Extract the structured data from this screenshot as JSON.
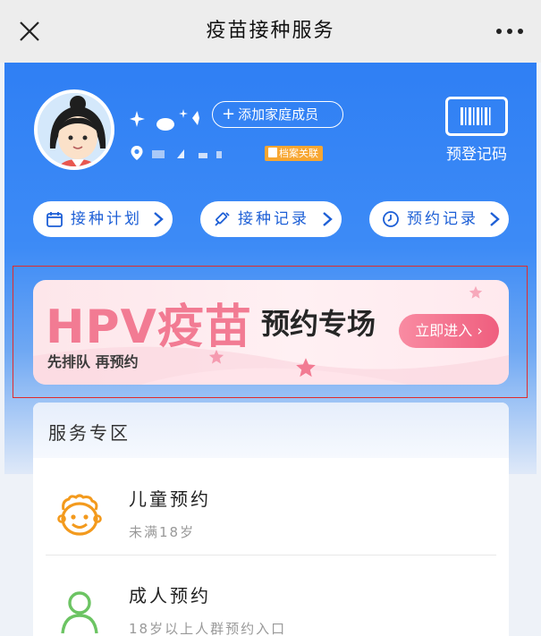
{
  "navbar": {
    "title": "疫苗接种服务",
    "close_icon": "close-icon",
    "more_icon": "more-icon"
  },
  "profile": {
    "add_family_label": "添加家庭成员",
    "archive_badge": "档案关联",
    "registration_record_label": "预登记码"
  },
  "quick_links": [
    {
      "label": "接种计划",
      "icon": "calendar-icon"
    },
    {
      "label": "接种记录",
      "icon": "syringe-icon"
    },
    {
      "label": "预约记录",
      "icon": "clock-icon"
    }
  ],
  "banner": {
    "title_latin": "HPV",
    "title_cn": "疫苗",
    "subtitle": "预约专场",
    "slogan": "先排队 再预约",
    "button": "立即进入 ›"
  },
  "service": {
    "title": "服务专区",
    "items": [
      {
        "name": "儿童预约",
        "desc": "未满18岁",
        "icon": "child-face-icon"
      },
      {
        "name": "成人预约",
        "desc": "18岁以上人群预约入口",
        "icon": "adult-person-icon"
      }
    ]
  },
  "colors": {
    "primary_blue": "#2f7ff4",
    "link_blue": "#1d5fd6",
    "banner_pink": "#f27b93",
    "badge_orange": "#f7a631",
    "highlight_red": "#e12b2b"
  }
}
